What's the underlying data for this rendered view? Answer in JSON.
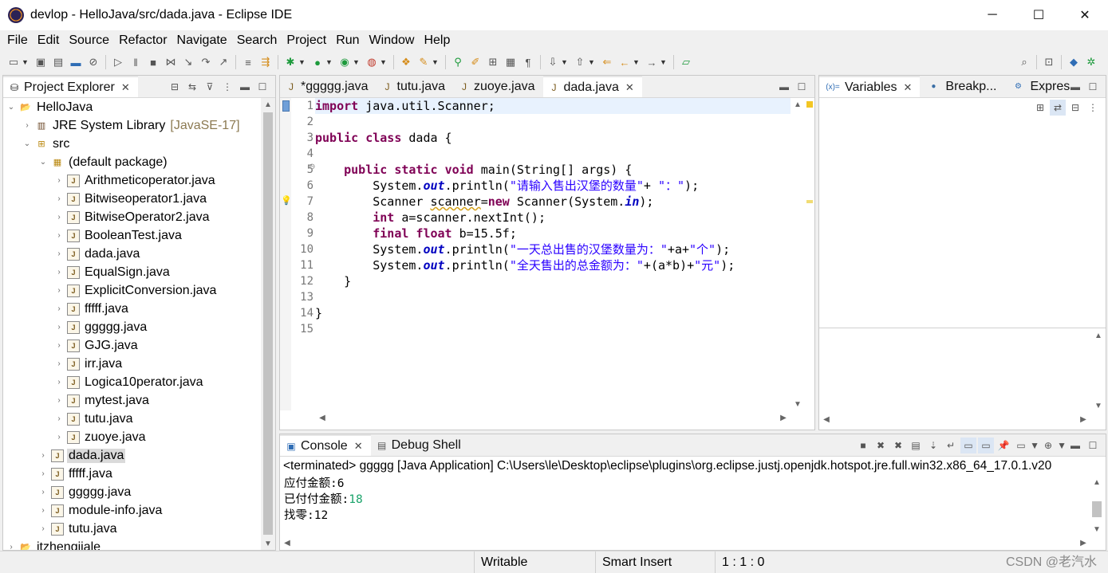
{
  "window": {
    "title": "devlop - HelloJava/src/dada.java - Eclipse IDE",
    "minimize": "─",
    "maximize": "☐",
    "close": "✕"
  },
  "menu": [
    "File",
    "Edit",
    "Source",
    "Refactor",
    "Navigate",
    "Search",
    "Project",
    "Run",
    "Window",
    "Help"
  ],
  "explorer": {
    "tab_label": "Project Explorer",
    "tree": [
      {
        "label": "HelloJava",
        "level": 0,
        "icon": "project-icon",
        "arrow": "v"
      },
      {
        "label": "JRE System Library",
        "decor": "[JavaSE-17]",
        "level": 1,
        "icon": "library-icon",
        "arrow": ">"
      },
      {
        "label": "src",
        "level": 1,
        "icon": "source-folder-icon",
        "arrow": "v"
      },
      {
        "label": "(default package)",
        "level": 2,
        "icon": "package-icon",
        "arrow": "v"
      },
      {
        "label": "Arithmeticoperator.java",
        "level": 3,
        "icon": "java-file-icon",
        "arrow": ">"
      },
      {
        "label": "Bitwiseoperator1.java",
        "level": 3,
        "icon": "java-file-icon",
        "arrow": ">"
      },
      {
        "label": "BitwiseOperator2.java",
        "level": 3,
        "icon": "java-file-icon",
        "arrow": ">"
      },
      {
        "label": "BooleanTest.java",
        "level": 3,
        "icon": "java-file-icon",
        "arrow": ">"
      },
      {
        "label": "dada.java",
        "level": 3,
        "icon": "java-file-icon",
        "arrow": ">"
      },
      {
        "label": "EqualSign.java",
        "level": 3,
        "icon": "java-file-icon",
        "arrow": ">"
      },
      {
        "label": "ExplicitConversion.java",
        "level": 3,
        "icon": "java-file-icon",
        "arrow": ">"
      },
      {
        "label": "fffff.java",
        "level": 3,
        "icon": "java-file-icon",
        "arrow": ">"
      },
      {
        "label": "ggggg.java",
        "level": 3,
        "icon": "java-file-icon",
        "arrow": ">"
      },
      {
        "label": "GJG.java",
        "level": 3,
        "icon": "java-file-icon",
        "arrow": ">"
      },
      {
        "label": "irr.java",
        "level": 3,
        "icon": "java-file-icon",
        "arrow": ">"
      },
      {
        "label": "Logica10perator.java",
        "level": 3,
        "icon": "java-file-icon",
        "arrow": ">"
      },
      {
        "label": "mytest.java",
        "level": 3,
        "icon": "java-file-icon",
        "arrow": ">"
      },
      {
        "label": "tutu.java",
        "level": 3,
        "icon": "java-file-icon",
        "arrow": ">"
      },
      {
        "label": "zuoye.java",
        "level": 3,
        "icon": "java-file-icon",
        "arrow": ">"
      },
      {
        "label": "dada.java",
        "level": 2,
        "icon": "java-file-icon",
        "arrow": ">",
        "selected": true
      },
      {
        "label": "fffff.java",
        "level": 2,
        "icon": "java-file-icon",
        "arrow": ">"
      },
      {
        "label": "ggggg.java",
        "level": 2,
        "icon": "java-file-icon",
        "arrow": ">"
      },
      {
        "label": "module-info.java",
        "level": 2,
        "icon": "java-file-icon",
        "arrow": ">"
      },
      {
        "label": "tutu.java",
        "level": 2,
        "icon": "java-file-icon",
        "arrow": ">"
      },
      {
        "label": "itzhengjiale",
        "level": 0,
        "icon": "project-icon",
        "arrow": ">"
      }
    ]
  },
  "editor": {
    "tabs": [
      {
        "label": "*ggggg.java",
        "active": false
      },
      {
        "label": "tutu.java",
        "active": false
      },
      {
        "label": "zuoye.java",
        "active": false
      },
      {
        "label": "dada.java",
        "active": true
      }
    ],
    "line_numbers": [
      "1",
      "2",
      "3",
      "4",
      "5",
      "6",
      "7",
      "8",
      "9",
      "10",
      "11",
      "12",
      "13",
      "14",
      "15"
    ],
    "lines": [
      [
        {
          "t": "import",
          "c": "kw"
        },
        {
          "t": " java.util.Scanner;"
        }
      ],
      [],
      [
        {
          "t": "public",
          "c": "kw"
        },
        {
          "t": " "
        },
        {
          "t": "class",
          "c": "kw"
        },
        {
          "t": " dada {"
        }
      ],
      [],
      [
        {
          "t": "    "
        },
        {
          "t": "public",
          "c": "kw"
        },
        {
          "t": " "
        },
        {
          "t": "static",
          "c": "kw"
        },
        {
          "t": " "
        },
        {
          "t": "void",
          "c": "kw"
        },
        {
          "t": " main(String[] args) {"
        }
      ],
      [
        {
          "t": "        System."
        },
        {
          "t": "out",
          "c": "fld"
        },
        {
          "t": ".println("
        },
        {
          "t": "\"请输入售出汉堡的数量\"",
          "c": "str"
        },
        {
          "t": "+ "
        },
        {
          "t": "\"：\"",
          "c": "str"
        },
        {
          "t": ");"
        }
      ],
      [
        {
          "t": "        Scanner "
        },
        {
          "t": "scanner",
          "c": "warn"
        },
        {
          "t": "="
        },
        {
          "t": "new",
          "c": "kw"
        },
        {
          "t": " Scanner(System."
        },
        {
          "t": "in",
          "c": "fld"
        },
        {
          "t": ");"
        }
      ],
      [
        {
          "t": "        "
        },
        {
          "t": "int",
          "c": "kw"
        },
        {
          "t": " a=scanner.nextInt();"
        }
      ],
      [
        {
          "t": "        "
        },
        {
          "t": "final",
          "c": "kw"
        },
        {
          "t": " "
        },
        {
          "t": "float",
          "c": "kw"
        },
        {
          "t": " b=15.5f;"
        }
      ],
      [
        {
          "t": "        System."
        },
        {
          "t": "out",
          "c": "fld"
        },
        {
          "t": ".println("
        },
        {
          "t": "\"一天总出售的汉堡数量为：\"",
          "c": "str"
        },
        {
          "t": "+a+"
        },
        {
          "t": "\"个\"",
          "c": "str"
        },
        {
          "t": ");"
        }
      ],
      [
        {
          "t": "        System."
        },
        {
          "t": "out",
          "c": "fld"
        },
        {
          "t": ".println("
        },
        {
          "t": "\"全天售出的总金额为：\"",
          "c": "str"
        },
        {
          "t": "+(a*b)+"
        },
        {
          "t": "\"元\"",
          "c": "str"
        },
        {
          "t": ");"
        }
      ],
      [
        {
          "t": "    }"
        }
      ],
      [],
      [
        {
          "t": "}"
        }
      ],
      []
    ]
  },
  "debug_views": {
    "tabs": [
      {
        "label": "Variables",
        "icon": "variables-icon",
        "active": true
      },
      {
        "label": "Breakp...",
        "icon": "breakpoints-icon",
        "active": false
      },
      {
        "label": "Expres...",
        "icon": "expressions-icon",
        "active": false
      }
    ]
  },
  "console": {
    "tabs": [
      {
        "label": "Console",
        "active": true
      },
      {
        "label": "Debug Shell",
        "active": false
      }
    ],
    "header": "<terminated> ggggg [Java Application] C:\\Users\\le\\Desktop\\eclipse\\plugins\\org.eclipse.justj.openjdk.hotspot.jre.full.win32.x86_64_17.0.1.v20",
    "lines": [
      {
        "text": "应付金额:6",
        "input": ""
      },
      {
        "text": "已付付金额:",
        "input": "18"
      },
      {
        "text": "找零:12",
        "input": ""
      }
    ]
  },
  "status": {
    "writable": "Writable",
    "insert_mode": "Smart Insert",
    "position": "1 : 1 : 0",
    "watermark": "CSDN @老汽水"
  },
  "colors": {
    "keyword": "#7f0055",
    "string": "#2a00ff",
    "field": "#0000c0",
    "console_input": "#1aa36a",
    "current_line": "#e8f2fe"
  }
}
